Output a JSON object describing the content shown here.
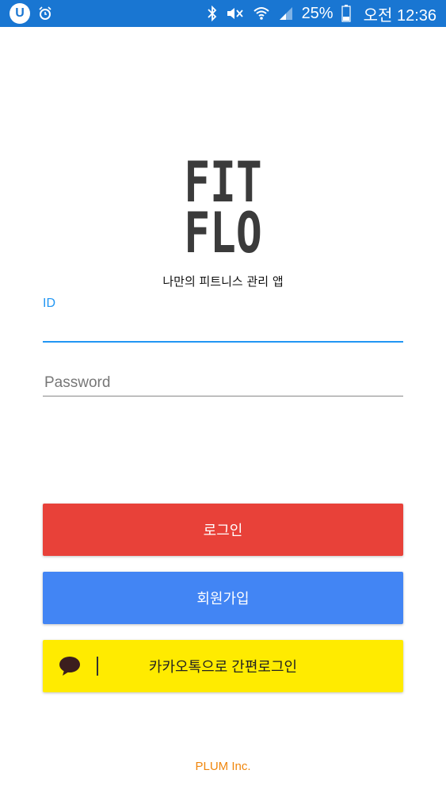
{
  "status_bar": {
    "app_icon_letter": "U",
    "battery_percent": "25%",
    "time": "오전 12:36",
    "icons": [
      "app-notification-icon",
      "alarm-icon",
      "bluetooth-icon",
      "mute-icon",
      "wifi-icon",
      "signal-icon",
      "battery-icon"
    ],
    "background": "#1976d2"
  },
  "logo": {
    "line1": "FIT",
    "line2": "FLO"
  },
  "tagline": "나만의 피트니스 관리 앱",
  "form": {
    "id_label": "ID",
    "id_value": "",
    "password_placeholder": "Password",
    "password_value": ""
  },
  "buttons": {
    "login": "로그인",
    "signup": "회원가입",
    "kakao": "카카오톡으로 간편로그인"
  },
  "colors": {
    "accent": "#2196f3",
    "login": "#e84139",
    "signup": "#4285f4",
    "kakao": "#ffeb00",
    "footer": "#f0860c"
  },
  "footer": "PLUM Inc."
}
